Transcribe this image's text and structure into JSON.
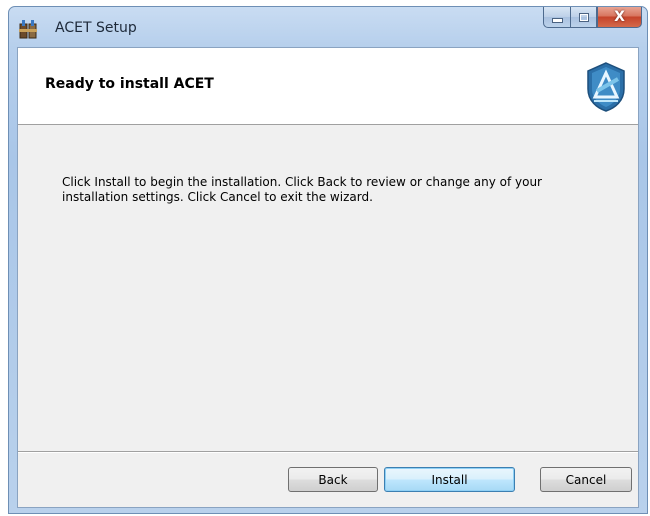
{
  "window": {
    "title": "ACET Setup",
    "caption_buttons": {
      "minimize_glyph": "—",
      "maximize_glyph": "□",
      "close_glyph": "X"
    }
  },
  "banner": {
    "title": "Ready to install ACET",
    "logo_icon": "acet-shield-logo-icon"
  },
  "body": {
    "message": "Click Install to begin the installation. Click Back to review or change any of your installation settings. Click Cancel to exit the wizard."
  },
  "buttons": {
    "back": "Back",
    "install": "Install",
    "cancel": "Cancel"
  },
  "colors": {
    "logo_blue": "#2b6fa8",
    "logo_light": "#7cc4ea",
    "install_focus": "#3c7fb1"
  }
}
